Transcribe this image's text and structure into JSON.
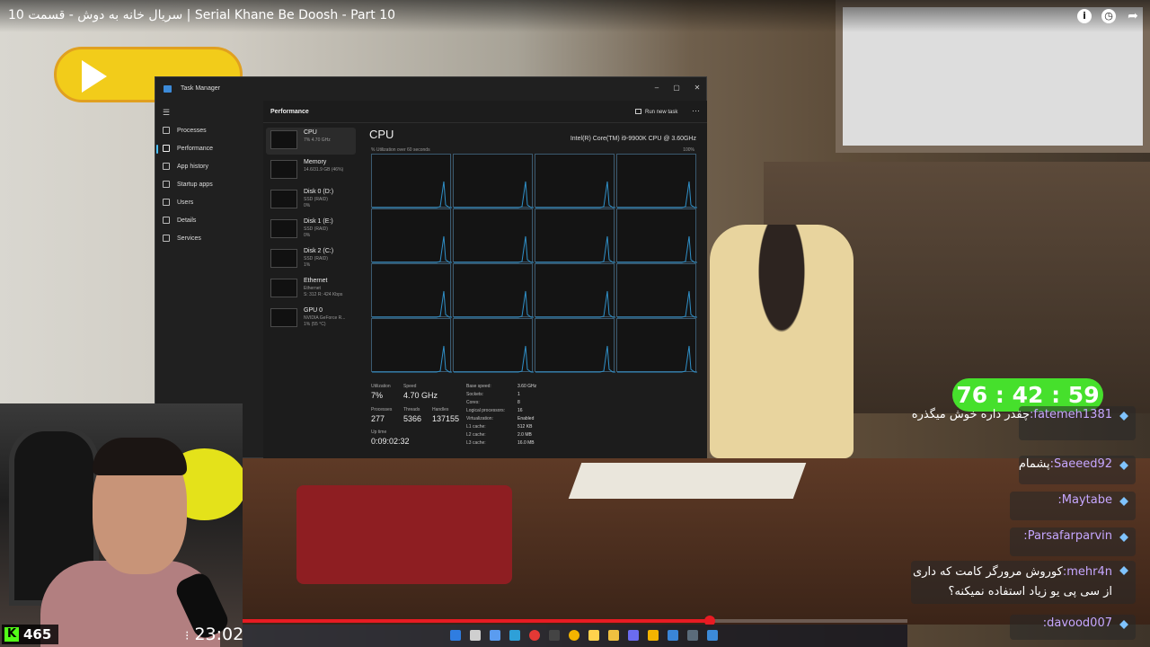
{
  "video": {
    "title": "سریال خانه به دوش - قسمت 10 | Serial Khane Be Doosh - Part 10",
    "icons": [
      "info-icon",
      "clock-icon",
      "share-icon"
    ],
    "progress_fraction": 0.703
  },
  "task_manager": {
    "window_title": "Task Manager",
    "nav": [
      {
        "label": "Processes",
        "icon": "processes-icon"
      },
      {
        "label": "Performance",
        "icon": "performance-icon",
        "active": true
      },
      {
        "label": "App history",
        "icon": "app-history-icon"
      },
      {
        "label": "Startup apps",
        "icon": "startup-icon"
      },
      {
        "label": "Users",
        "icon": "users-icon"
      },
      {
        "label": "Details",
        "icon": "details-icon"
      },
      {
        "label": "Services",
        "icon": "services-icon"
      }
    ],
    "header": {
      "title": "Performance",
      "run_new_task": "Run new task"
    },
    "resources": [
      {
        "name": "CPU",
        "sub1": "7% 4.70 GHz",
        "sub2": "",
        "sub3": ""
      },
      {
        "name": "Memory",
        "sub1": "14.6/31.9 GB (46%)",
        "sub2": "",
        "sub3": ""
      },
      {
        "name": "Disk 0 (D:)",
        "sub1": "SSD (RAID)",
        "sub2": "0%",
        "sub3": ""
      },
      {
        "name": "Disk 1 (E:)",
        "sub1": "SSD (RAID)",
        "sub2": "0%",
        "sub3": ""
      },
      {
        "name": "Disk 2 (C:)",
        "sub1": "SSD (RAID)",
        "sub2": "1%",
        "sub3": ""
      },
      {
        "name": "Ethernet",
        "sub1": "Ethernet",
        "sub2": "S: 312 R: 424 Kbps",
        "sub3": ""
      },
      {
        "name": "GPU 0",
        "sub1": "NVIDIA GeForce R...",
        "sub2": "1% (55 °C)",
        "sub3": ""
      }
    ],
    "cpu": {
      "heading": "CPU",
      "model": "Intel(R) Core(TM) i9-9900K CPU @ 3.60GHz",
      "util_label": "% Utilization over 60 seconds",
      "max_label": "100%",
      "stats": {
        "utilization_label": "Utilization",
        "utilization": "7%",
        "speed_label": "Speed",
        "speed": "4.70 GHz",
        "processes_label": "Processes",
        "processes": "277",
        "threads_label": "Threads",
        "threads": "5366",
        "handles_label": "Handles",
        "handles": "137155",
        "uptime_label": "Up time",
        "uptime": "0:09:02:32"
      },
      "specs": [
        {
          "label": "Base speed:",
          "value": "3.60 GHz"
        },
        {
          "label": "Sockets:",
          "value": "1"
        },
        {
          "label": "Cores:",
          "value": "8"
        },
        {
          "label": "Logical processors:",
          "value": "16"
        },
        {
          "label": "Virtualization:",
          "value": "Enabled"
        },
        {
          "label": "L1 cache:",
          "value": "512 KB"
        },
        {
          "label": "L2 cache:",
          "value": "2.0 MB"
        },
        {
          "label": "L3 cache:",
          "value": "16.0 MB"
        }
      ]
    }
  },
  "stream": {
    "timer": "76 : 42 : 59",
    "clock": "23:02",
    "viewers": "465",
    "chat": [
      {
        "user": "fatemeh1381",
        "message": "چقدر داره خوش میگذره"
      },
      {
        "user": "Saeeed92",
        "message": "پشمام"
      },
      {
        "user": "Maytabe",
        "message": ""
      },
      {
        "user": "Parsafarparvin",
        "message": ""
      },
      {
        "user": "mehr4n",
        "message": "کوروش مرورگر کامت که داری از سی پی یو زیاد استفاده نمیکنه؟"
      },
      {
        "user": "davood007",
        "message": ""
      }
    ]
  },
  "taskbar": {
    "icons": [
      "windows-start-icon",
      "search-icon",
      "task-view-icon",
      "edge-icon",
      "youtube-icon",
      "obs-icon",
      "chrome-icon",
      "files-icon",
      "notes-icon",
      "discord-icon",
      "folder-icon",
      "remote-icon",
      "terminal-icon",
      "task-manager-icon"
    ]
  }
}
